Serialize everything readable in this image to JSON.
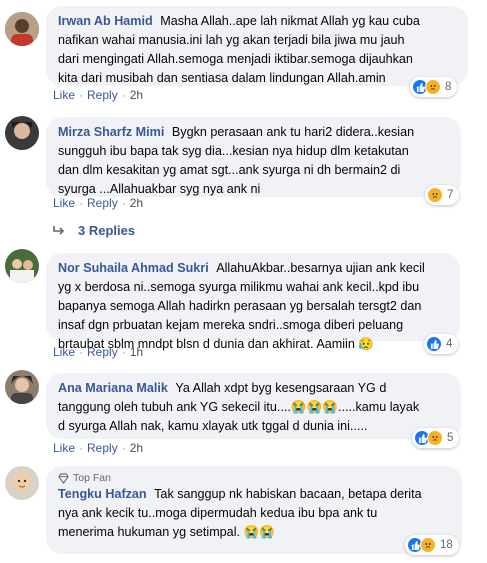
{
  "comments": [
    {
      "author": "Irwan Ab Hamid",
      "lines": [
        "Masha Allah..ape lah nikmat Allah yg kau cuba",
        "nafikan wahai manusia.ini lah yg akan terjadi bila jiwa mu jauh",
        "dari mengingati Allah.semoga menjadi iktibar.semoga dijauhkan",
        "kita dari musibah dan sentiasa dalam lindungan Allah.amin"
      ],
      "like": "Like",
      "reply": "Reply",
      "time": "2h",
      "reaction_count": "8",
      "reactions": [
        "like-icon",
        "sad-icon"
      ]
    },
    {
      "author": "Mirza Sharfz Mimi",
      "lines": [
        "Bygkn perasaan ank tu hari2 didera..kesian",
        "sungguh ibu bapa tak syg dia...kesian nya hidup dlm ketakutan",
        "dan dlm kesakitan yg amat sgt...ank syurga ni dh bermain2 di",
        "syurga ...Allahuakbar syg nya ank ni"
      ],
      "like": "Like",
      "reply": "Reply",
      "time": "2h",
      "reaction_count": "7",
      "reactions": [
        "sad-icon"
      ]
    },
    {
      "author": "Nor Suhaila Ahmad Sukri",
      "lines": [
        "AllahuAkbar..besarnya ujian ank kecil",
        "yg x berdosa ni..semoga syurga milikmu wahai ank kecil..kpd ibu",
        "bapanya semoga Allah hadirkn perasaan yg bersalah tersgt2 dan",
        "insaf dgn prbuatan kejam mereka sndri..smoga diberi peluang",
        "brtaubat sblm mndpt blsn d dunia dan akhirat. Aamiin 😥"
      ],
      "like": "Like",
      "reply": "Reply",
      "time": "1h",
      "reaction_count": "4",
      "reactions": [
        "like-icon"
      ]
    },
    {
      "author": "Ana Mariana Malik",
      "lines": [
        "Ya Allah xdpt byg kesengsaraan YG d",
        "tanggung oleh tubuh ank YG sekecil itu....😭😭😭.....kamu layak",
        "d syurga Allah nak, kamu xlayak utk tggal d dunia ini....."
      ],
      "like": "Like",
      "reply": "Reply",
      "time": "2h",
      "reaction_count": "5",
      "reactions": [
        "like-icon",
        "sad-icon"
      ]
    },
    {
      "badge": "Top Fan",
      "author": "Tengku Hafzan",
      "lines": [
        "Tak sanggup nk habiskan bacaan, betapa derita",
        "nya ank kecik tu..moga dipermudah kedua ibu bpa ank tu",
        "menerima hukuman yg setimpal. 😭😭"
      ],
      "reaction_count": "18",
      "reactions": [
        "like-icon",
        "sad-icon"
      ]
    }
  ],
  "replies_label": "3 Replies",
  "colors": {
    "author": "#385898",
    "bubble": "#f0f2f5",
    "like": "#1877f2",
    "sad": "#f7b125"
  }
}
